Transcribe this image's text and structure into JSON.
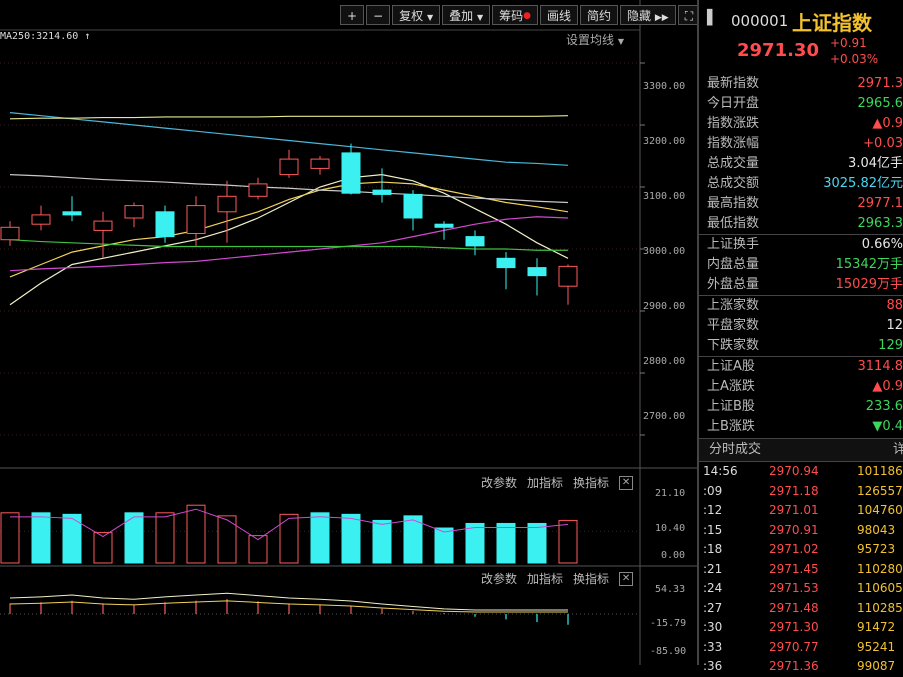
{
  "toolbar": {
    "plus": "+",
    "minus": "−",
    "fuquan": "复权",
    "diejia": "叠加",
    "chouma": "筹码",
    "huaxian": "画线",
    "fangyue": "简约",
    "yincang": "隐藏",
    "expand": "⛶"
  },
  "main_chart": {
    "ma_label": "MA250:3214.60",
    "set_ma": "设置均线",
    "y_ticks": [
      "3300.00",
      "3200.00",
      "3100.00",
      "3000.00",
      "2900.00",
      "2800.00",
      "2700.00"
    ]
  },
  "vol_panel": {
    "change_params": "改参数",
    "add_indicator": "加指标",
    "switch_indicator": "换指标",
    "y_ticks": [
      "21.10",
      "10.40",
      "0.00"
    ]
  },
  "macd_panel": {
    "change_params": "改参数",
    "add_indicator": "加指标",
    "switch_indicator": "换指标",
    "y_ticks": [
      "54.33",
      "-15.79",
      "-85.90"
    ]
  },
  "chart_data": {
    "type": "candlestick",
    "y_range": [
      2650,
      3350
    ],
    "candles": [
      {
        "o": 3015,
        "c": 3035,
        "h": 3045,
        "l": 3005,
        "dir": "up"
      },
      {
        "o": 3040,
        "c": 3055,
        "h": 3070,
        "l": 3030,
        "dir": "up"
      },
      {
        "o": 3060,
        "c": 3055,
        "h": 3085,
        "l": 3045,
        "dir": "down"
      },
      {
        "o": 3030,
        "c": 3045,
        "h": 3060,
        "l": 2985,
        "dir": "up"
      },
      {
        "o": 3050,
        "c": 3070,
        "h": 3075,
        "l": 3035,
        "dir": "up"
      },
      {
        "o": 3060,
        "c": 3020,
        "h": 3070,
        "l": 3010,
        "dir": "down"
      },
      {
        "o": 3025,
        "c": 3070,
        "h": 3085,
        "l": 3005,
        "dir": "up"
      },
      {
        "o": 3060,
        "c": 3085,
        "h": 3110,
        "l": 3010,
        "dir": "up"
      },
      {
        "o": 3085,
        "c": 3105,
        "h": 3115,
        "l": 3080,
        "dir": "up"
      },
      {
        "o": 3120,
        "c": 3145,
        "h": 3160,
        "l": 3115,
        "dir": "up"
      },
      {
        "o": 3130,
        "c": 3145,
        "h": 3150,
        "l": 3120,
        "dir": "up"
      },
      {
        "o": 3155,
        "c": 3090,
        "h": 3170,
        "l": 3088,
        "dir": "down"
      },
      {
        "o": 3095,
        "c": 3088,
        "h": 3130,
        "l": 3075,
        "dir": "down"
      },
      {
        "o": 3088,
        "c": 3050,
        "h": 3095,
        "l": 3030,
        "dir": "down"
      },
      {
        "o": 3040,
        "c": 3035,
        "h": 3045,
        "l": 3015,
        "dir": "down"
      },
      {
        "o": 3020,
        "c": 3005,
        "h": 3030,
        "l": 2990,
        "dir": "down"
      },
      {
        "o": 2985,
        "c": 2970,
        "h": 2995,
        "l": 2935,
        "dir": "down"
      },
      {
        "o": 2970,
        "c": 2957,
        "h": 2985,
        "l": 2925,
        "dir": "down"
      },
      {
        "o": 2940,
        "c": 2972,
        "h": 2975,
        "l": 2910,
        "dir": "up"
      }
    ],
    "ma_lines": [
      {
        "color": "#f0f0c8",
        "values": [
          2910,
          2945,
          2975,
          2985,
          2995,
          3005,
          3015,
          3030,
          3050,
          3075,
          3100,
          3115,
          3120,
          3110,
          3090,
          3065,
          3040,
          3010,
          2985
        ]
      },
      {
        "color": "#f2d25a",
        "values": [
          2955,
          2975,
          2995,
          3005,
          3015,
          3020,
          3030,
          3045,
          3060,
          3080,
          3095,
          3105,
          3108,
          3105,
          3095,
          3085,
          3075,
          3068,
          3060
        ]
      },
      {
        "color": "#d04ad0",
        "values": [
          2965,
          2968,
          2970,
          2972,
          2975,
          2978,
          2980,
          2985,
          2990,
          2995,
          3000,
          3005,
          3010,
          3020,
          3030,
          3040,
          3048,
          3052,
          3050
        ]
      },
      {
        "color": "#40c040",
        "values": [
          3015,
          3012,
          3010,
          3008,
          3006,
          3004,
          3004,
          3004,
          3004,
          3004,
          3004,
          3004,
          3004,
          3004,
          3002,
          3000,
          3000,
          2998,
          2998
        ]
      },
      {
        "color": "#c8c8c8",
        "values": [
          3120,
          3118,
          3115,
          3112,
          3110,
          3108,
          3105,
          3103,
          3100,
          3098,
          3095,
          3093,
          3090,
          3088,
          3085,
          3082,
          3080,
          3077,
          3075
        ]
      },
      {
        "color": "#4ab8d8",
        "values": [
          3220,
          3215,
          3210,
          3205,
          3200,
          3195,
          3190,
          3185,
          3180,
          3175,
          3170,
          3165,
          3160,
          3155,
          3150,
          3145,
          3140,
          3138,
          3135
        ]
      },
      {
        "color": "#e8e890",
        "values": [
          3210,
          3211,
          3211,
          3212,
          3212,
          3213,
          3213,
          3213,
          3213,
          3214,
          3214,
          3214,
          3214,
          3214,
          3214,
          3214,
          3214,
          3214,
          3215
        ]
      }
    ],
    "volume": [
      {
        "v": 16.5,
        "dir": "up"
      },
      {
        "v": 16.5,
        "dir": "down"
      },
      {
        "v": 16.0,
        "dir": "down"
      },
      {
        "v": 10.0,
        "dir": "up"
      },
      {
        "v": 16.5,
        "dir": "down"
      },
      {
        "v": 16.5,
        "dir": "up"
      },
      {
        "v": 19.0,
        "dir": "up"
      },
      {
        "v": 15.5,
        "dir": "up"
      },
      {
        "v": 9.0,
        "dir": "up"
      },
      {
        "v": 16.0,
        "dir": "up"
      },
      {
        "v": 16.5,
        "dir": "down"
      },
      {
        "v": 16.0,
        "dir": "down"
      },
      {
        "v": 14.0,
        "dir": "down"
      },
      {
        "v": 15.5,
        "dir": "down"
      },
      {
        "v": 11.5,
        "dir": "down"
      },
      {
        "v": 13.0,
        "dir": "down"
      },
      {
        "v": 13.0,
        "dir": "down"
      },
      {
        "v": 13.0,
        "dir": "down"
      },
      {
        "v": 14.0,
        "dir": "up"
      }
    ],
    "vol_range": [
      0,
      24
    ],
    "macd": [
      20,
      22,
      25,
      20,
      18,
      22,
      25,
      28,
      24,
      20,
      18,
      15,
      10,
      6,
      2,
      -5,
      -10,
      -15,
      -20
    ],
    "macd_range": [
      -85.9,
      54.33
    ]
  },
  "panel": {
    "win_icon": "▌",
    "code": "000001",
    "name": "上证指数",
    "price": "2971.30",
    "chg": "+0.91",
    "chg_pct": "+0.03%",
    "group1": [
      {
        "k": "最新指数",
        "v": "2971.3",
        "c": "red"
      },
      {
        "k": "今日开盘",
        "v": "2965.6",
        "c": "green"
      },
      {
        "k": "指数涨跌",
        "v": "▲0.9",
        "c": "red"
      },
      {
        "k": "指数涨幅",
        "v": "+0.03",
        "c": "red"
      },
      {
        "k": "总成交量",
        "v": "3.04亿手",
        "c": "white"
      },
      {
        "k": "总成交额",
        "v": "3025.82亿元",
        "c": "cyan"
      },
      {
        "k": "最高指数",
        "v": "2977.1",
        "c": "red"
      },
      {
        "k": "最低指数",
        "v": "2963.3",
        "c": "green"
      }
    ],
    "group2": [
      {
        "k": "上证换手",
        "v": "0.66%",
        "c": "white"
      },
      {
        "k": "内盘总量",
        "v": "15342万手",
        "c": "green"
      },
      {
        "k": "外盘总量",
        "v": "15029万手",
        "c": "red"
      }
    ],
    "group3": [
      {
        "k": "上涨家数",
        "v": "88",
        "c": "red"
      },
      {
        "k": "平盘家数",
        "v": "12",
        "c": "white"
      },
      {
        "k": "下跌家数",
        "v": "129",
        "c": "green"
      }
    ],
    "group4": [
      {
        "k": "上证A股",
        "v": "3114.8",
        "c": "red"
      },
      {
        "k": "上A涨跌",
        "v": "▲0.9",
        "c": "red"
      },
      {
        "k": "上证B股",
        "v": "233.6",
        "c": "green"
      },
      {
        "k": "上B涨跌",
        "v": "▼0.4",
        "c": "green"
      }
    ],
    "tick_title": "分时成交",
    "tick_detail": "详",
    "ticks": [
      {
        "t": "14:56",
        "p": "2970.94",
        "v": "101186"
      },
      {
        "t": ":09",
        "p": "2971.18",
        "v": "126557"
      },
      {
        "t": ":12",
        "p": "2971.01",
        "v": "104760"
      },
      {
        "t": ":15",
        "p": "2970.91",
        "v": "98043"
      },
      {
        "t": ":18",
        "p": "2971.02",
        "v": "95723"
      },
      {
        "t": ":21",
        "p": "2971.45",
        "v": "110280"
      },
      {
        "t": ":24",
        "p": "2971.53",
        "v": "110605"
      },
      {
        "t": ":27",
        "p": "2971.48",
        "v": "110285"
      },
      {
        "t": ":30",
        "p": "2971.30",
        "v": "91472"
      },
      {
        "t": ":33",
        "p": "2970.77",
        "v": "95241"
      },
      {
        "t": ":36",
        "p": "2971.36",
        "v": "99087"
      }
    ]
  }
}
